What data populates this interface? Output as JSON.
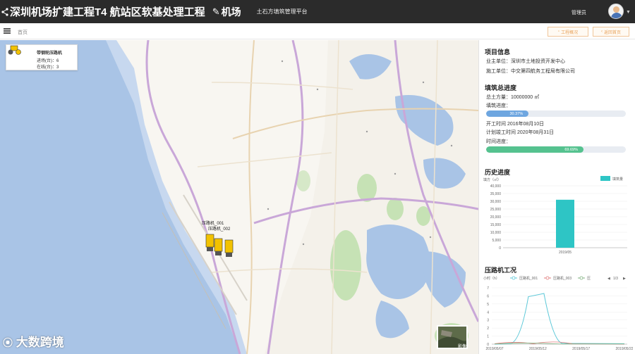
{
  "header": {
    "title": "深圳机场扩建工程T4 航站区软基处理工程",
    "subtitle": "机场",
    "platform": "土石方填筑管理平台",
    "user_name": "管理员",
    "colors": {
      "bg": "#2b2b2b",
      "text": "#ffffff"
    }
  },
  "toolbar": {
    "breadcrumb": "首页",
    "btn1_label": "工程概况",
    "btn2_label": "返回首页"
  },
  "map": {
    "legend": {
      "title": "带钢轮压路机",
      "line1": "进场(台)：6",
      "line2": "在线(台)：3"
    },
    "markers": [
      {
        "label": "压路机_001"
      },
      {
        "label": "压路机_002"
      }
    ],
    "satellite_label": "影像",
    "watermark": "大数跨境"
  },
  "panel": {
    "project_info": {
      "title": "项目信息",
      "owner": "业主单位：深圳市土地投资开发中心",
      "contractor": "施工单位：中交第四航务工程局有限公司"
    },
    "fill_progress": {
      "title": "填筑总进度",
      "total": "总土方量：10000000 ㎡",
      "fill_label": "填筑进度：",
      "fill_pct_text": "30.37%",
      "fill_pct": 0.3037,
      "start": "开工时间 2016年08月10日",
      "end": "计划竣工时间 2020年08月31日",
      "time_label": "时间进度：",
      "time_pct_text": "69.69%",
      "time_pct": 0.6969
    },
    "history": {
      "title": "历史进度"
    },
    "roller": {
      "title": "压路机工况"
    }
  },
  "chart_data": [
    {
      "type": "bar",
      "title": "历史进度",
      "ylabel": "填方（㎡）",
      "categories": [
        "2019/05"
      ],
      "series": [
        {
          "name": "填筑量",
          "values": [
            31000
          ]
        }
      ],
      "ylim": [
        0,
        40000
      ],
      "yticks": [
        "0",
        "5,000",
        "10,000",
        "15,000",
        "20,000",
        "25,000",
        "30,000",
        "35,000",
        "40,000"
      ],
      "legend": "top-right",
      "color": "#2ec5c5"
    },
    {
      "type": "line",
      "title": "压路机工况",
      "ylabel": "小时（h）",
      "x": [
        "2019/05/07",
        "2019/05/12",
        "2019/05/17",
        "2019/05/22"
      ],
      "ylim": [
        0,
        7
      ],
      "yticks": [
        "0",
        "1",
        "2",
        "3",
        "4",
        "5",
        "6",
        "7"
      ],
      "legend": "top",
      "legend_page": "1/3",
      "series": [
        {
          "name": "压路机_001",
          "color": "#5cc8d8"
        },
        {
          "name": "压路机_003",
          "color": "#e07b7b"
        },
        {
          "name": "压",
          "color": "#7fb27f"
        }
      ]
    }
  ]
}
